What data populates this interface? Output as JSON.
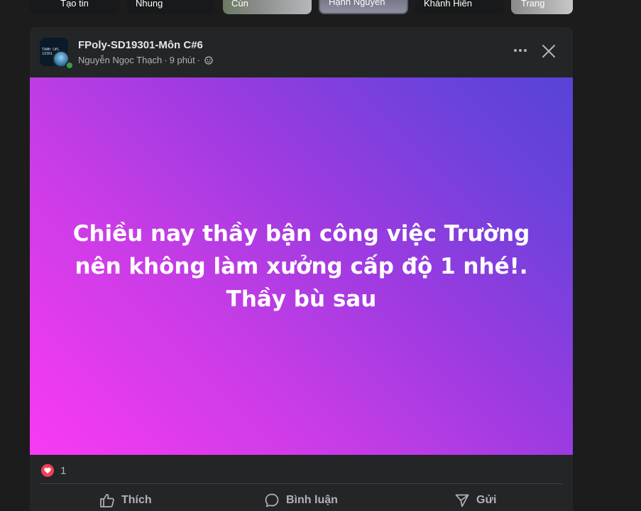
{
  "stories": [
    {
      "name": "Tạo tin"
    },
    {
      "name": "Nhung"
    },
    {
      "name": "Cún"
    },
    {
      "name": "Hạnh Nguyễn"
    },
    {
      "name": "Khánh Hiền"
    },
    {
      "name": "Trang"
    }
  ],
  "post": {
    "group_name": "FPoly-SD19301-Môn C#6",
    "author": "Nguyễn Ngọc Thạch",
    "time": "9 phút",
    "separator": "·",
    "avatar_text": "TANH C#1 19301",
    "icons": {
      "more": "more-options-icon",
      "close": "close-icon",
      "audience": "globe-icon"
    },
    "text": "Chiều nay thầy bận công việc Trường nên không làm xưởng cấp độ 1 nhé!. Thầy bù sau",
    "background_colors": [
      "#f93af3",
      "#5843d6"
    ],
    "reaction_count": "1",
    "actions": {
      "like": "Thích",
      "comment": "Bình luận",
      "share": "Gửi"
    }
  }
}
